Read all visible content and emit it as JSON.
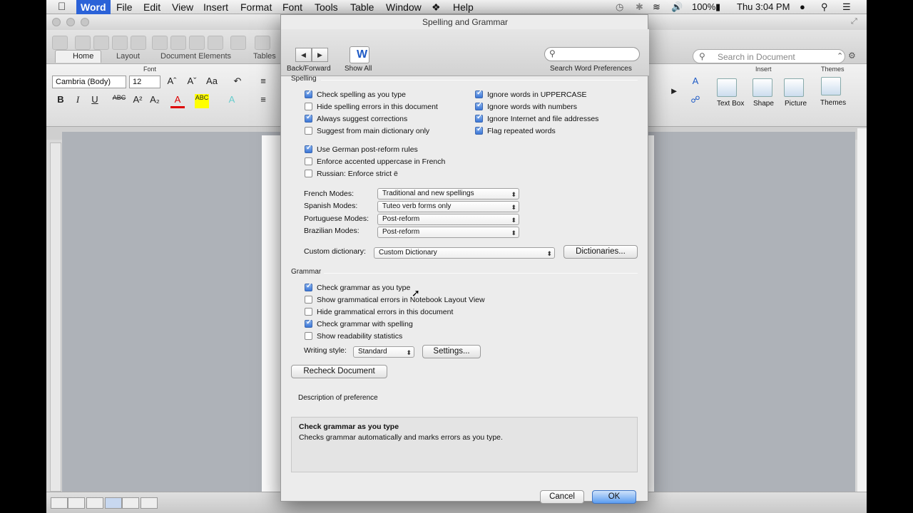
{
  "menubar": {
    "items": [
      "Word",
      "File",
      "Edit",
      "View",
      "Insert",
      "Format",
      "Font",
      "Tools",
      "Table",
      "Window",
      "Help"
    ],
    "battery": "100%",
    "clock": "Thu 3:04 PM"
  },
  "word": {
    "search_placeholder": "Search in Document",
    "ribbon_tabs": [
      "Home",
      "Layout",
      "Document Elements",
      "Tables"
    ],
    "font_group_label": "Font",
    "font_name": "Cambria (Body)",
    "font_size": "12",
    "insert_group_label": "Insert",
    "themes_group_label": "Themes",
    "text_box_label": "Text Box",
    "shape_label": "Shape",
    "picture_label": "Picture",
    "themes_label": "Themes"
  },
  "dialog": {
    "title": "Spelling and Grammar",
    "back_forward_label": "Back/Forward",
    "show_all_label": "Show All",
    "search_label": "Search Word Preferences",
    "spelling_section": "Spelling",
    "spelling_left": [
      {
        "label": "Check spelling as you type",
        "checked": true
      },
      {
        "label": "Hide spelling errors in this document",
        "checked": false
      },
      {
        "label": "Always suggest corrections",
        "checked": true
      },
      {
        "label": "Suggest from main dictionary only",
        "checked": false
      }
    ],
    "spelling_right": [
      {
        "label": "Ignore words in UPPERCASE",
        "checked": true
      },
      {
        "label": "Ignore words with numbers",
        "checked": true
      },
      {
        "label": "Ignore Internet and file addresses",
        "checked": true
      },
      {
        "label": "Flag repeated words",
        "checked": true
      }
    ],
    "language_options": [
      {
        "label": "Use German post-reform rules",
        "checked": true
      },
      {
        "label": "Enforce accented uppercase in French",
        "checked": false
      },
      {
        "label": "Russian: Enforce strict ë",
        "checked": false
      }
    ],
    "modes": [
      {
        "label": "French Modes:",
        "value": "Traditional and new spellings"
      },
      {
        "label": "Spanish Modes:",
        "value": "Tuteo verb forms only"
      },
      {
        "label": "Portuguese Modes:",
        "value": "Post-reform"
      },
      {
        "label": "Brazilian Modes:",
        "value": "Post-reform"
      }
    ],
    "custom_dictionary_label": "Custom dictionary:",
    "custom_dictionary_value": "Custom Dictionary",
    "dictionaries_button": "Dictionaries...",
    "grammar_section": "Grammar",
    "grammar_options": [
      {
        "label": "Check grammar as you type",
        "checked": true
      },
      {
        "label": "Show grammatical errors in Notebook Layout View",
        "checked": false
      },
      {
        "label": "Hide grammatical errors in this document",
        "checked": false
      },
      {
        "label": "Check grammar with spelling",
        "checked": true
      },
      {
        "label": "Show readability statistics",
        "checked": false
      }
    ],
    "writing_style_label": "Writing style:",
    "writing_style_value": "Standard",
    "settings_button": "Settings...",
    "recheck_button": "Recheck Document",
    "description_label": "Description of preference",
    "description_title": "Check grammar as you type",
    "description_text": "Checks grammar automatically and marks errors as you type.",
    "cancel_button": "Cancel",
    "ok_button": "OK"
  }
}
